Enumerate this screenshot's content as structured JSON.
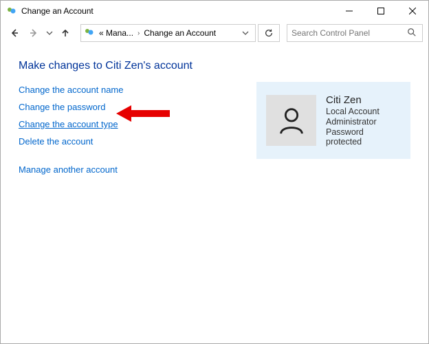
{
  "titlebar": {
    "title": "Change an Account"
  },
  "breadcrumb": {
    "truncated": "«  Mana...",
    "current": "Change an Account"
  },
  "search": {
    "placeholder": "Search Control Panel"
  },
  "heading": "Make changes to Citi Zen's account",
  "links": {
    "change_name": "Change the account name",
    "change_password": "Change the password",
    "change_type": "Change the account type",
    "delete_account": "Delete the account",
    "manage_another": "Manage another account"
  },
  "account": {
    "name": "Citi Zen",
    "type": "Local Account",
    "role": "Administrator",
    "pw_status": "Password protected"
  }
}
